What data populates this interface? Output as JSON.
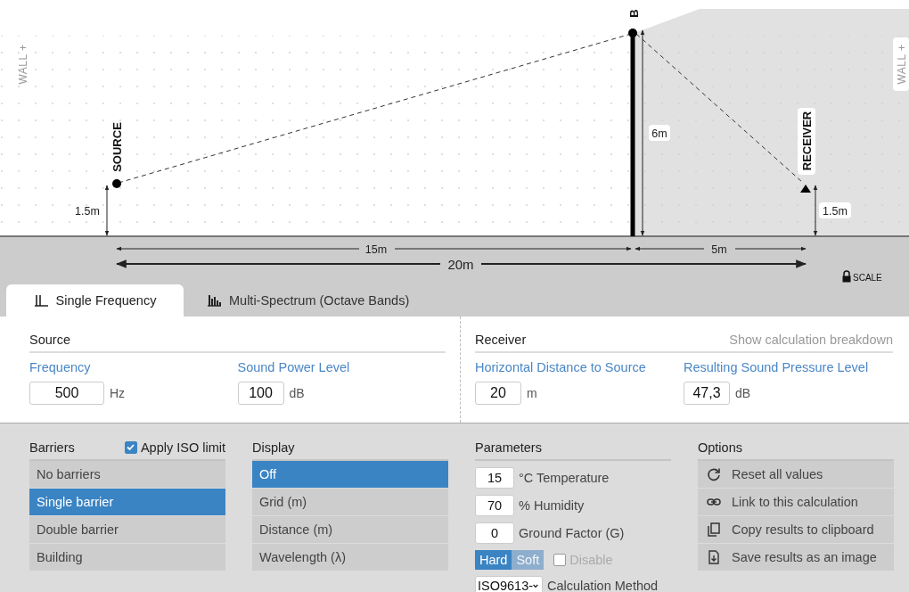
{
  "diagram": {
    "wall_left": "WALL +",
    "wall_right": "WALL +",
    "source_label": "SOURCE",
    "barrier_label": "B",
    "receiver_label": "RECEIVER",
    "source_height": "1.5m",
    "barrier_height": "6m",
    "receiver_height": "1.5m",
    "source_to_barrier": "15m",
    "barrier_to_receiver": "5m",
    "total_distance": "20m",
    "scale": "SCALE"
  },
  "tabs": [
    {
      "label": "Single Frequency",
      "kind": "single",
      "selected": true
    },
    {
      "label": "Multi-Spectrum (Octave Bands)",
      "kind": "bars",
      "selected": false
    }
  ],
  "source": {
    "title": "Source",
    "fields": [
      {
        "label": "Frequency",
        "value": "500",
        "unit": "Hz"
      },
      {
        "label": "Sound Power Level",
        "value": "100",
        "unit": "dB"
      }
    ]
  },
  "receiver": {
    "title": "Receiver",
    "link": "Show calculation breakdown",
    "fields": [
      {
        "label": "Horizontal Distance to Source",
        "value": "20",
        "unit": "m"
      },
      {
        "label": "Resulting Sound Pressure Level",
        "value": "47,3",
        "unit": "dB"
      }
    ]
  },
  "barriers": {
    "title": "Barriers",
    "iso_limit": {
      "label": "Apply ISO limit",
      "checked": true
    },
    "items": [
      {
        "label": "No barriers",
        "selected": false
      },
      {
        "label": "Single barrier",
        "selected": true
      },
      {
        "label": "Double barrier",
        "selected": false
      },
      {
        "label": "Building",
        "selected": false
      }
    ]
  },
  "display": {
    "title": "Display",
    "items": [
      {
        "label": "Off",
        "selected": true
      },
      {
        "label": "Grid (m)",
        "selected": false
      },
      {
        "label": "Distance (m)",
        "selected": false
      },
      {
        "label": "Wavelength (λ)",
        "selected": false
      }
    ]
  },
  "parameters": {
    "title": "Parameters",
    "fields": [
      {
        "value": "15",
        "label": "°C Temperature"
      },
      {
        "value": "70",
        "label": "% Humidity"
      },
      {
        "value": "0",
        "label": "Ground Factor (G)"
      }
    ],
    "ground": [
      {
        "label": "Hard",
        "selected": true
      },
      {
        "label": "Soft",
        "selected": false
      }
    ],
    "disable": {
      "label": "Disable",
      "checked": false
    },
    "method": {
      "value": "ISO9613-",
      "label": "Calculation Method"
    }
  },
  "options": {
    "title": "Options",
    "items": [
      {
        "label": "Reset all values",
        "kind": "reset"
      },
      {
        "label": "Link to this calculation",
        "kind": "link"
      },
      {
        "label": "Copy results to clipboard",
        "kind": "copy"
      },
      {
        "label": "Save results as an image",
        "kind": "save"
      }
    ]
  }
}
